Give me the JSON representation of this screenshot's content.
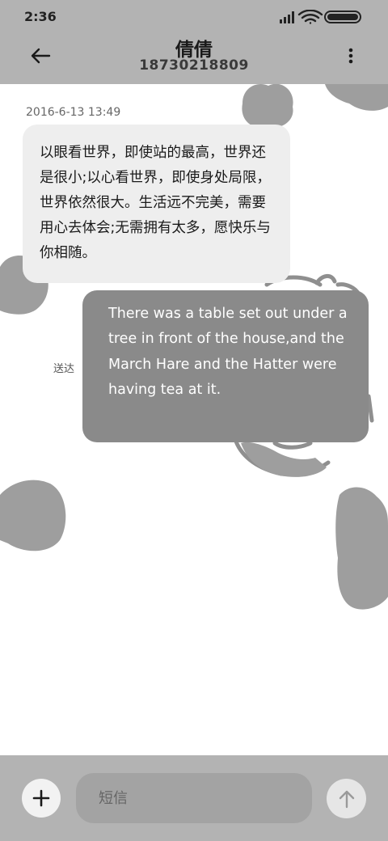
{
  "status_bar": {
    "time": "2:36",
    "icons": [
      "signal-icon",
      "wifi-icon",
      "battery-icon"
    ]
  },
  "header": {
    "contact_name": "倩倩",
    "contact_number": "18730218809",
    "back_icon": "arrow-left-icon",
    "more_icon": "more-vertical-icon"
  },
  "conversation": {
    "timestamp": "2016-6-13 13:49",
    "incoming_message": "以眼看世界，即使站的最高，世界还是很小;以心看世界，即使身处局限，世界依然很大。生活远不完美，需要用心去体会;无需拥有太多，愿快乐与你相随。",
    "outgoing_message": "There was a table set out under a tree in front of the house,and the March Hare and the Hatter were having tea at it.",
    "outgoing_status": "送达"
  },
  "composer": {
    "placeholder": "短信",
    "add_icon": "plus-icon",
    "send_icon": "arrow-up-icon"
  },
  "colors": {
    "header_bg": "#b3b3b3",
    "incoming_bubble": "#eeeeee",
    "outgoing_bubble": "#8a8a8a",
    "input_bg": "#a3a3a3"
  }
}
